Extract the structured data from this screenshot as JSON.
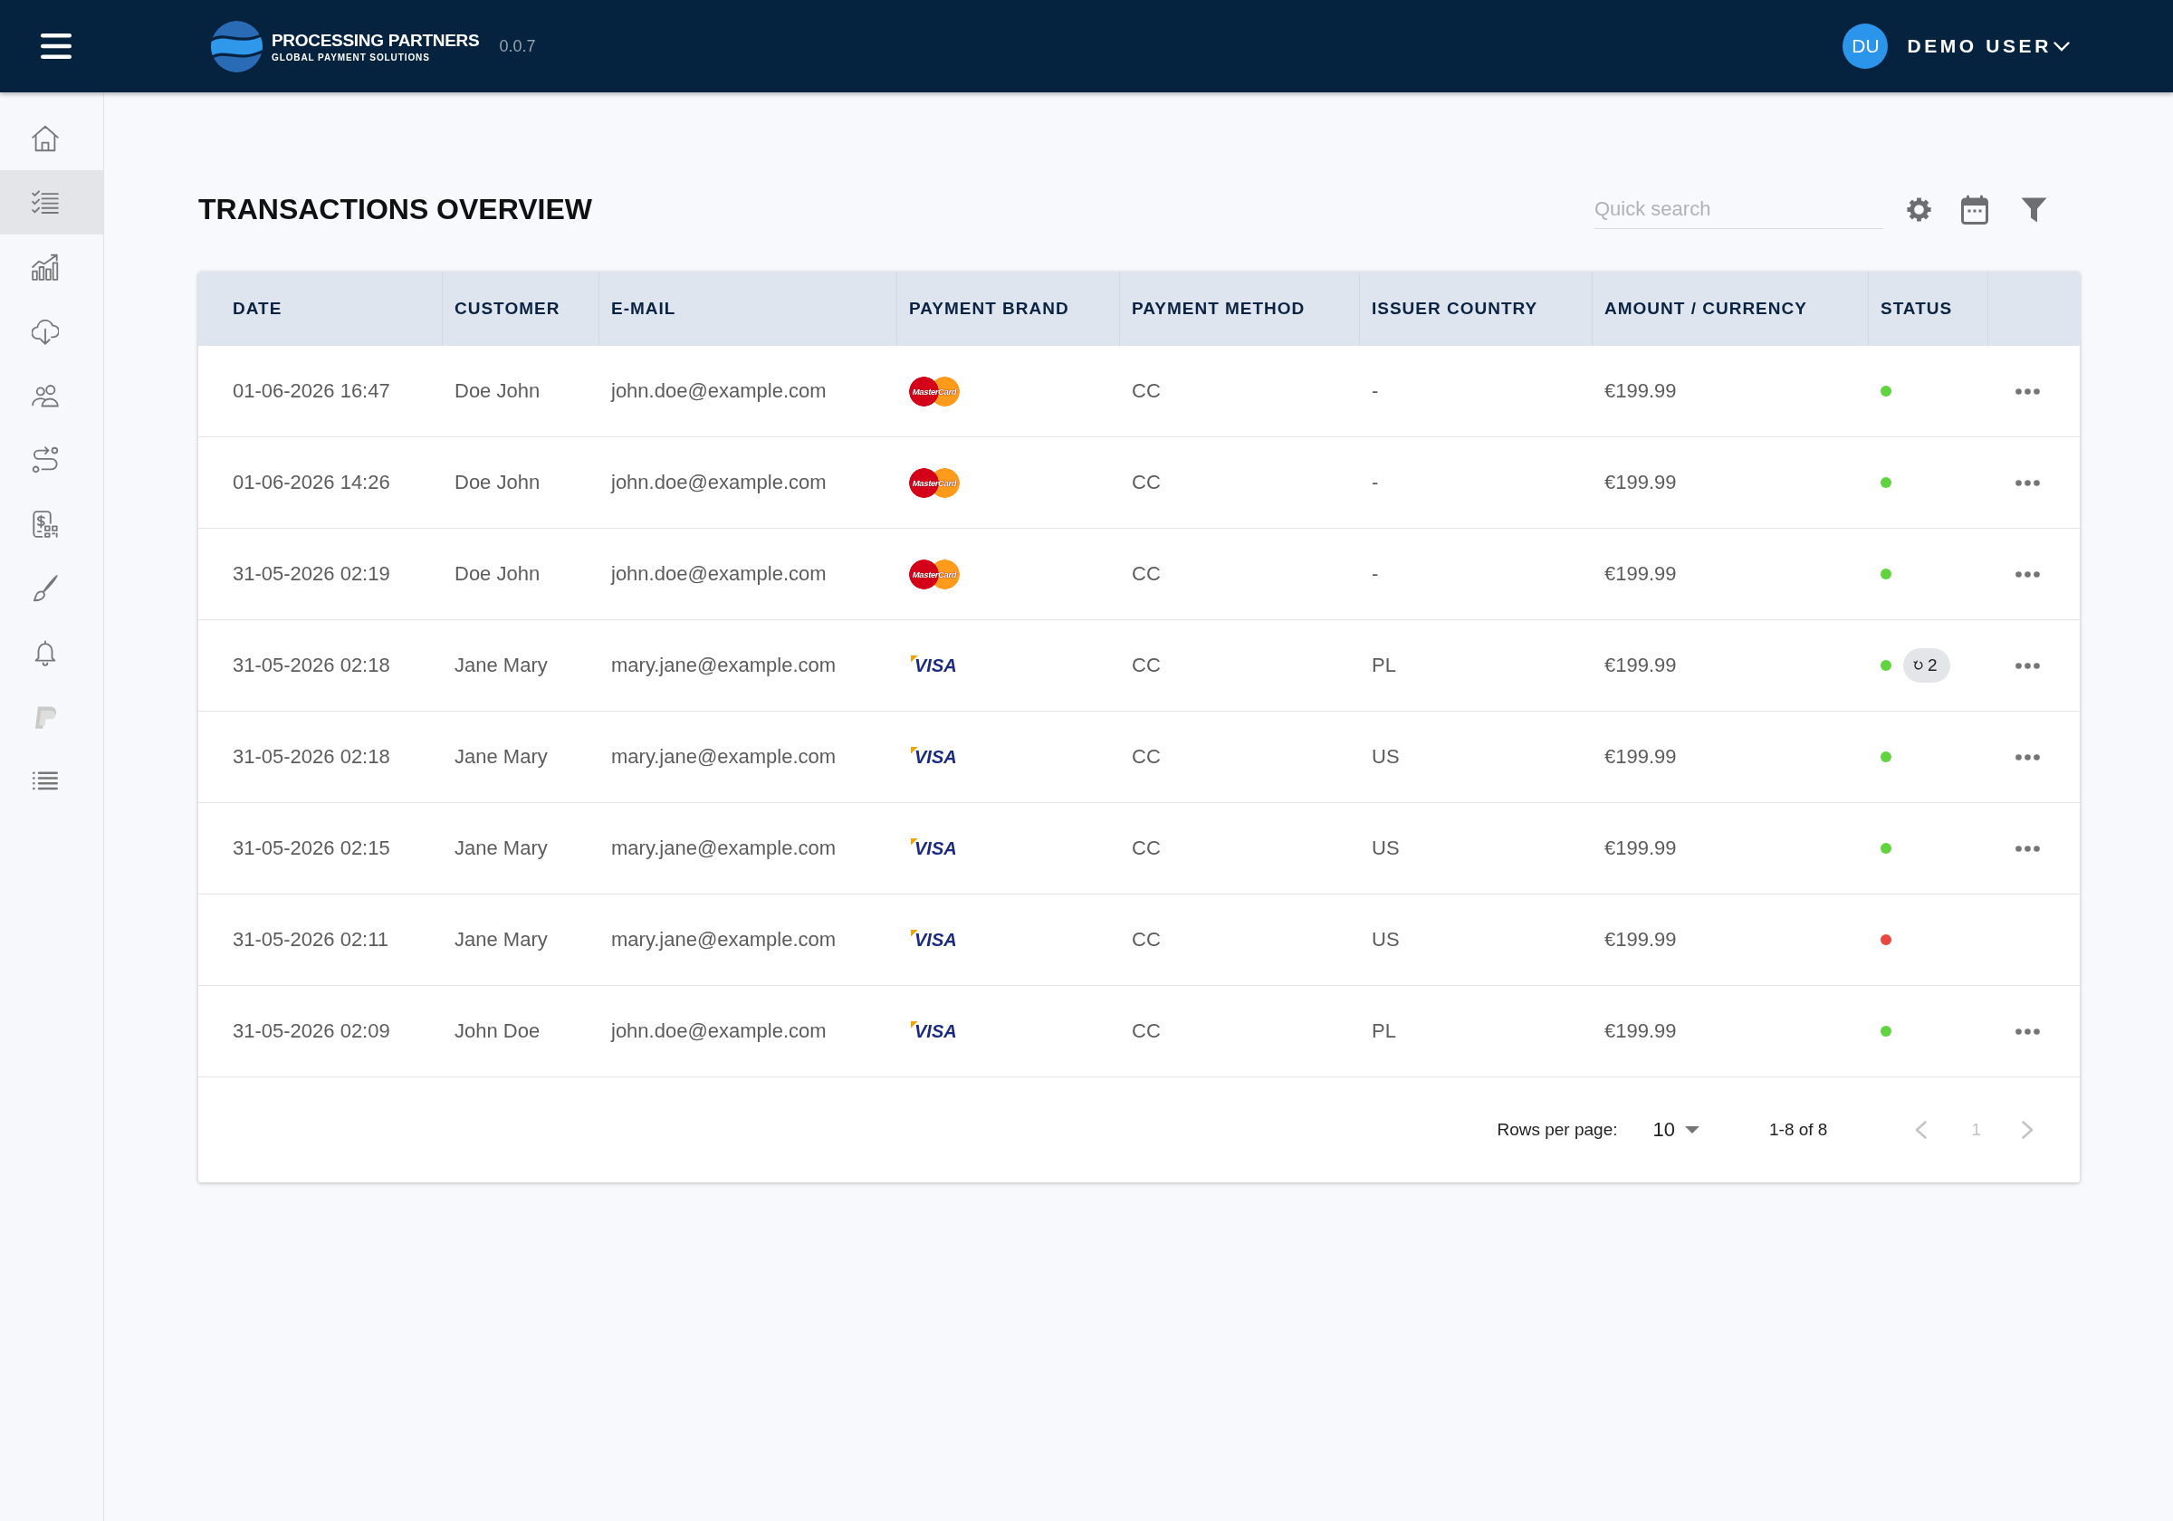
{
  "header": {
    "brand_name": "PROCESSING PARTNERS",
    "brand_tagline": "GLOBAL PAYMENT SOLUTIONS",
    "version": "0.0.7",
    "user": {
      "initials": "DU",
      "name": "DEMO USER"
    }
  },
  "sidebar": {
    "items": [
      {
        "kind": "home",
        "selected": false
      },
      {
        "kind": "checklist",
        "selected": true
      },
      {
        "kind": "chart",
        "selected": false
      },
      {
        "kind": "cloud_download",
        "selected": false
      },
      {
        "kind": "users",
        "selected": false
      },
      {
        "kind": "route",
        "selected": false
      },
      {
        "kind": "payment_qr",
        "selected": false
      },
      {
        "kind": "brush",
        "selected": false
      },
      {
        "kind": "bell",
        "selected": false
      },
      {
        "kind": "p_logo",
        "selected": false
      },
      {
        "kind": "list",
        "selected": false
      }
    ]
  },
  "page": {
    "title": "TRANSACTIONS OVERVIEW",
    "search": {
      "placeholder": "Quick search"
    }
  },
  "table": {
    "columns": [
      "DATE",
      "CUSTOMER",
      "E-MAIL",
      "PAYMENT BRAND",
      "PAYMENT METHOD",
      "ISSUER COUNTRY",
      "AMOUNT / CURRENCY",
      "STATUS"
    ],
    "rows": [
      {
        "date": "01-06-2026 16:47",
        "customer": "Doe John",
        "email": "john.doe@example.com",
        "payment_brand": {
          "kind": "mastercard",
          "label": "MasterCard"
        },
        "payment_method": "CC",
        "issuer_country": "-",
        "amount": "€199.99",
        "status": {
          "color": "#5fd43f"
        },
        "menu": true
      },
      {
        "date": "01-06-2026 14:26",
        "customer": "Doe John",
        "email": "john.doe@example.com",
        "payment_brand": {
          "kind": "mastercard",
          "label": "MasterCard"
        },
        "payment_method": "CC",
        "issuer_country": "-",
        "amount": "€199.99",
        "status": {
          "color": "#5fd43f"
        },
        "menu": true
      },
      {
        "date": "31-05-2026 02:19",
        "customer": "Doe John",
        "email": "john.doe@example.com",
        "payment_brand": {
          "kind": "mastercard",
          "label": "MasterCard"
        },
        "payment_method": "CC",
        "issuer_country": "-",
        "amount": "€199.99",
        "status": {
          "color": "#5fd43f"
        },
        "menu": true
      },
      {
        "date": "31-05-2026 02:18",
        "customer": "Jane Mary",
        "email": "mary.jane@example.com",
        "payment_brand": {
          "kind": "visa",
          "label": "VISA"
        },
        "payment_method": "CC",
        "issuer_country": "PL",
        "amount": "€199.99",
        "status": {
          "color": "#5fd43f"
        },
        "retry_count": "2",
        "menu": true
      },
      {
        "date": "31-05-2026 02:18",
        "customer": "Jane Mary",
        "email": "mary.jane@example.com",
        "payment_brand": {
          "kind": "visa",
          "label": "VISA"
        },
        "payment_method": "CC",
        "issuer_country": "US",
        "amount": "€199.99",
        "status": {
          "color": "#5fd43f"
        },
        "menu": true
      },
      {
        "date": "31-05-2026 02:15",
        "customer": "Jane Mary",
        "email": "mary.jane@example.com",
        "payment_brand": {
          "kind": "visa",
          "label": "VISA"
        },
        "payment_method": "CC",
        "issuer_country": "US",
        "amount": "€199.99",
        "status": {
          "color": "#5fd43f"
        },
        "menu": true
      },
      {
        "date": "31-05-2026 02:11",
        "customer": "Jane Mary",
        "email": "mary.jane@example.com",
        "payment_brand": {
          "kind": "visa",
          "label": "VISA"
        },
        "payment_method": "CC",
        "issuer_country": "US",
        "amount": "€199.99",
        "status": {
          "color": "#e8463e"
        },
        "menu": false
      },
      {
        "date": "31-05-2026 02:09",
        "customer": "John Doe",
        "email": "john.doe@example.com",
        "payment_brand": {
          "kind": "visa",
          "label": "VISA"
        },
        "payment_method": "CC",
        "issuer_country": "PL",
        "amount": "€199.99",
        "status": {
          "color": "#5fd43f"
        },
        "menu": true
      }
    ]
  },
  "pagination": {
    "rows_per_page_label": "Rows per page:",
    "rows_per_page": "10",
    "range": "1-8 of 8",
    "page": "1",
    "prev_disabled": true,
    "next_disabled": true
  }
}
